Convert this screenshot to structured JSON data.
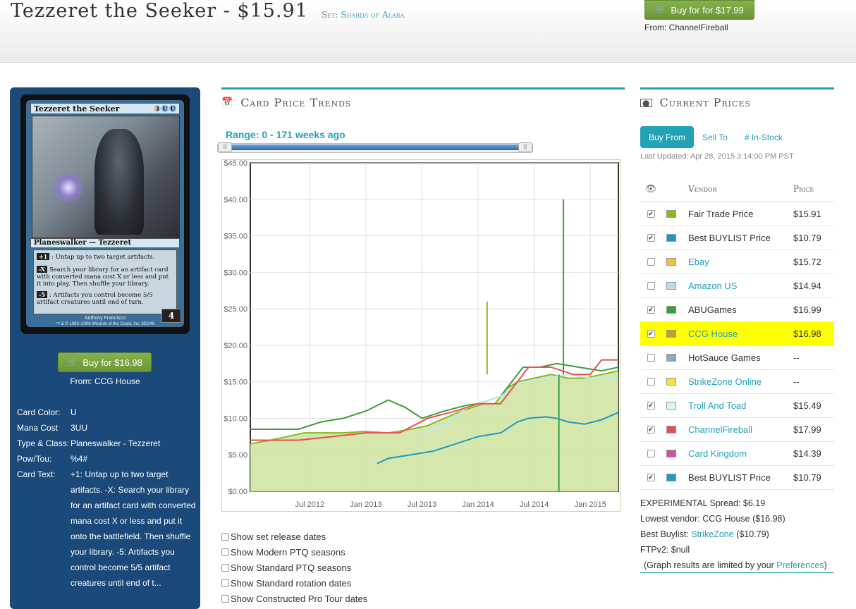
{
  "header": {
    "card_name": "Tezzeret the Seeker",
    "price": " - $15.91",
    "set_label": "Set:",
    "set_name": "Shards of Alara",
    "buy_button": "Buy for for $17.99",
    "buy_from": "From: ChannelFireball"
  },
  "card": {
    "name": "Tezzeret the Seeker",
    "mana_symbols": [
      "3",
      "U",
      "U"
    ],
    "type_line": "Planeswalker — Tezzeret",
    "abilities": [
      {
        "cost": "+1",
        "text": ": Untap up to two target artifacts."
      },
      {
        "cost": "-X",
        "text": "Search your library for an artifact card with converted mana cost X or less and put it into play. Then shuffle your library."
      },
      {
        "cost": "-5",
        "text": ": Artifacts you control become 5/5 artifact creatures until end of turn."
      }
    ],
    "loyalty": "4",
    "artist": "Anthony Francisco",
    "copyright": "™ & © 1993–2008 Wizards of the Coast, Inc. 60/249",
    "buy_button": "Buy for $16.98",
    "buy_from": "From: CCG House",
    "properties": [
      {
        "label": "Card Color:",
        "value": "U"
      },
      {
        "label": "Mana Cost",
        "value": "3UU"
      },
      {
        "label": "Type & Class:",
        "value": "Planeswalker - Tezzeret"
      },
      {
        "label": "Pow/Tou:",
        "value": "%4#"
      },
      {
        "label": "Card Text:",
        "value": "+1: Untap up to two target artifacts. -X: Search your library for an artifact card with converted mana cost X or less and put it onto the battlefield. Then shuffle your library. -5: Artifacts you control become 5/5 artifact creatures until end of t..."
      }
    ]
  },
  "trends": {
    "title": "Card Price Trends",
    "range_label": "Range: 0 - 171 weeks ago",
    "options": [
      "Show set release dates",
      "Show Modern PTQ seasons",
      "Show Standard PTQ seasons",
      "Show Standard rotation dates",
      "Show Constructed Pro Tour dates"
    ]
  },
  "chart_data": {
    "type": "line",
    "title": "",
    "xlabel": "",
    "ylabel": "",
    "ylim": [
      0,
      45
    ],
    "yticks": [
      "$0.00",
      "$5.00",
      "$10.00",
      "$15.00",
      "$20.00",
      "$25.00",
      "$30.00",
      "$35.00",
      "$40.00",
      "$45.00"
    ],
    "xticks": [
      "Jul 2012",
      "Jan 2013",
      "Jul 2013",
      "Jan 2014",
      "Jul 2014",
      "Jan 2015"
    ],
    "xticks_at": [
      2012.5,
      2013.0,
      2013.5,
      2014.0,
      2014.5,
      2015.0
    ],
    "xlim": [
      2011.97,
      2015.25
    ],
    "grid": true,
    "series": [
      {
        "name": "Fair Trade Price",
        "color": "#8cb81a",
        "area": true,
        "x": [
          2011.97,
          2012.15,
          2012.3,
          2012.45,
          2012.6,
          2012.8,
          2013.0,
          2013.2,
          2013.4,
          2013.55,
          2013.7,
          2013.85,
          2013.95,
          2014.05,
          2014.15,
          2014.25,
          2014.35,
          2014.5,
          2014.65,
          2014.8,
          2014.95,
          2015.1,
          2015.25
        ],
        "y": [
          6.5,
          7.0,
          7.5,
          8.0,
          8.0,
          8.0,
          8.2,
          8.0,
          8.5,
          9.0,
          10.0,
          11.0,
          11.5,
          12.0,
          12.0,
          14.0,
          15.0,
          15.5,
          16.0,
          15.5,
          15.5,
          16.0,
          16.5
        ]
      },
      {
        "name": "Best BUYLIST Price",
        "color": "#1a9ac4",
        "area": false,
        "x": [
          2013.1,
          2013.2,
          2013.4,
          2013.6,
          2013.8,
          2014.0,
          2014.2,
          2014.35,
          2014.45,
          2014.6,
          2014.7,
          2014.8,
          2014.95,
          2015.1,
          2015.25
        ],
        "y": [
          3.8,
          4.5,
          5.0,
          5.5,
          6.5,
          7.5,
          8.0,
          9.5,
          10.0,
          10.2,
          10.0,
          9.5,
          9.2,
          9.8,
          10.8
        ]
      },
      {
        "name": "ABUGames",
        "color": "#3a9e3a",
        "area": false,
        "x": [
          2011.97,
          2012.2,
          2012.4,
          2012.6,
          2012.8,
          2013.0,
          2013.2,
          2013.35,
          2013.5,
          2013.7,
          2013.9,
          2014.0,
          2014.2,
          2014.4,
          2014.55,
          2014.7,
          2014.9,
          2015.1,
          2015.25
        ],
        "y": [
          8.5,
          8.5,
          8.5,
          9.5,
          10.0,
          11.0,
          12.5,
          11.5,
          10.0,
          11.0,
          11.8,
          12.0,
          13.0,
          17.0,
          17.0,
          17.5,
          17.0,
          16.5,
          17.0
        ]
      },
      {
        "name": "Troll And Toad",
        "color": "#b9ecf0",
        "area": false,
        "x": [
          2013.5,
          2013.7,
          2013.9,
          2014.0,
          2014.2,
          2014.4,
          2014.6,
          2014.8,
          2015.0,
          2015.25
        ],
        "y": [
          8.0,
          9.0,
          11.5,
          12.0,
          13.0,
          15.0,
          15.5,
          16.0,
          15.5,
          15.5
        ]
      },
      {
        "name": "ChannelFireball",
        "color": "#e85050",
        "area": false,
        "x": [
          2011.97,
          2012.4,
          2012.7,
          2013.0,
          2013.3,
          2013.55,
          2013.8,
          2014.0,
          2014.2,
          2014.45,
          2014.65,
          2014.85,
          2015.0,
          2015.1,
          2015.25
        ],
        "y": [
          7.0,
          7.0,
          7.5,
          8.0,
          8.0,
          10.0,
          11.0,
          12.0,
          12.0,
          17.0,
          17.0,
          16.0,
          16.0,
          18.0,
          18.0
        ]
      }
    ],
    "spikes": [
      {
        "x": 2014.08,
        "y": 26.0,
        "color": "#8cb81a"
      },
      {
        "x": 2014.76,
        "y": 40.0,
        "color": "#3a9e3a"
      },
      {
        "x": 2014.72,
        "y": 0.0,
        "color": "#3a9e3a"
      }
    ]
  },
  "prices": {
    "title": "Current Prices",
    "tabs": [
      "Buy From",
      "Sell To",
      "# In-Stock"
    ],
    "last_updated": "Last Updated: Apr 28, 2015 3:14:00 PM PST",
    "headers": {
      "eye": "",
      "vendor": "Vendor",
      "price": "Price"
    },
    "rows": [
      {
        "vendor": "Fair Trade Price",
        "price": "$15.91",
        "checked": true,
        "color": "#8cb81a",
        "link": false
      },
      {
        "vendor": "Best BUYLIST Price",
        "price": "$10.79",
        "checked": true,
        "color": "#1a9ac4",
        "link": false
      },
      {
        "vendor": "Ebay",
        "price": "$15.72",
        "checked": false,
        "color": "#f0c040",
        "link": true
      },
      {
        "vendor": "Amazon US",
        "price": "$14.94",
        "checked": false,
        "color": "#b8dcf0",
        "link": true
      },
      {
        "vendor": "ABUGames",
        "price": "$16.99",
        "checked": true,
        "color": "#3a9e3a",
        "link": false
      },
      {
        "vendor": "CCG House",
        "price": "$16.98",
        "checked": true,
        "color": "#c0a030",
        "link": true,
        "highlight": true
      },
      {
        "vendor": "HotSauce Games",
        "price": "--",
        "checked": false,
        "color": "#8aa8c8",
        "link": false
      },
      {
        "vendor": "StrikeZone Online",
        "price": "--",
        "checked": false,
        "color": "#f8e040",
        "link": true
      },
      {
        "vendor": "Troll And Toad",
        "price": "$15.49",
        "checked": true,
        "color": "#d8f8f8",
        "link": true
      },
      {
        "vendor": "ChannelFireball",
        "price": "$17.99",
        "checked": true,
        "color": "#e85050",
        "link": true
      },
      {
        "vendor": "Card Kingdom",
        "price": "$14.39",
        "checked": false,
        "color": "#d050a0",
        "link": true
      },
      {
        "vendor": "Best BUYLIST Price",
        "price": "$10.79",
        "checked": true,
        "color": "#1a9ac4",
        "link": false
      }
    ],
    "summary": {
      "spread": "EXPERIMENTAL Spread: $6.19",
      "lowest": "Lowest vendor: CCG House ($16.98)",
      "best_buylist_label": "Best Buylist: ",
      "best_buylist_vendor": "StrikeZone",
      "best_buylist_price": " ($10.79)",
      "ftp": "FTPv2: $null",
      "note_pre": "(Graph results are limited by your ",
      "note_link": "Preferences",
      "note_post": ")"
    }
  }
}
